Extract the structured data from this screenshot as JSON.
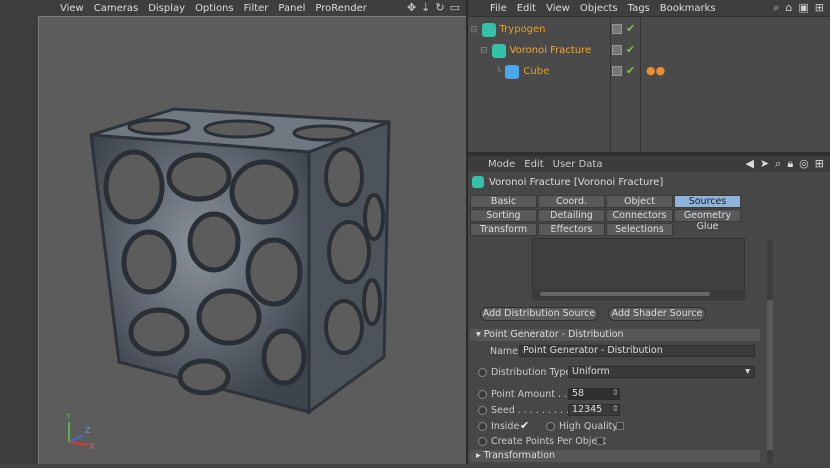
{
  "viewport": {
    "menu": [
      "View",
      "Cameras",
      "Display",
      "Options",
      "Filter",
      "Panel",
      "ProRender"
    ],
    "axis_labels": {
      "y": "Y",
      "z": "Z",
      "x": "X"
    }
  },
  "object_manager": {
    "menu": [
      "File",
      "Edit",
      "View",
      "Objects",
      "Tags",
      "Bookmarks"
    ],
    "objects": [
      {
        "name": "Trypogen",
        "icon_color": "#35c0a8"
      },
      {
        "name": "Voronoi Fracture",
        "icon_color": "#35c0a8"
      },
      {
        "name": "Cube",
        "icon_color": "#4aa8e8"
      }
    ]
  },
  "attribute_manager": {
    "menu": [
      "Mode",
      "Edit",
      "User Data"
    ],
    "title": "Voronoi Fracture [Voronoi Fracture]",
    "tabs_row1": [
      "Basic",
      "Coord.",
      "Object",
      "Sources"
    ],
    "tabs_row2": [
      "Sorting",
      "Detailing",
      "Connectors",
      "Geometry Glue"
    ],
    "tabs_row3": [
      "Transform",
      "Effectors",
      "Selections"
    ],
    "active_tab": "Sources",
    "buttons": {
      "add_distribution": "Add Distribution Source",
      "add_shader": "Add Shader Source"
    },
    "section_point_generator": "Point Generator - Distribution",
    "name_label": "Name",
    "name_value": "Point Generator - Distribution",
    "distribution_type_label": "Distribution Type",
    "distribution_type_value": "Uniform",
    "point_amount_label": "Point Amount . .",
    "point_amount_value": "58",
    "seed_label": "Seed . . . . . . . . .",
    "seed_value": "12345",
    "inside_label": "Inside",
    "high_quality_label": "High Quality",
    "create_points_label": "Create Points Per Object",
    "section_transformation": "Transformation"
  },
  "colors": {
    "accent_tab": "#8eb4dc",
    "object_name": "#e8a020"
  }
}
